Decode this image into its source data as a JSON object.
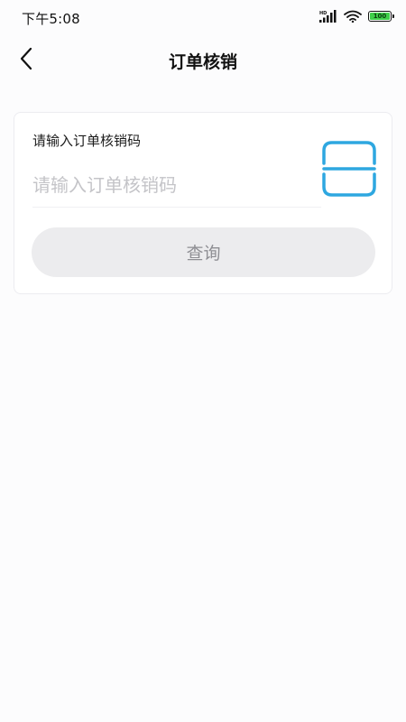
{
  "status_bar": {
    "time": "下午5:08",
    "battery_level": "100",
    "battery_percent": 100,
    "battery_color": "#3fcf4a"
  },
  "nav": {
    "back_icon": "chevron-left-icon",
    "title": "订单核销"
  },
  "form": {
    "label": "请输入订单核销码",
    "input_value": "",
    "input_placeholder": "请输入订单核销码",
    "scan_icon": "scan-icon",
    "scan_color": "#2ea7e0",
    "query_label": "查询"
  }
}
